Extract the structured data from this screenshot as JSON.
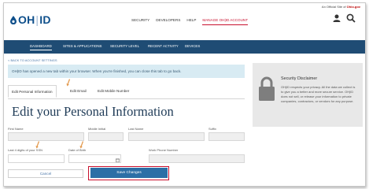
{
  "official_site": {
    "prefix": "An Official Site of",
    "state": "Ohio.gov"
  },
  "brand": {
    "left": "OH",
    "right": "ID"
  },
  "main_nav": [
    "SECURITY",
    "DEVELOPERS",
    "HELP",
    "MANAGE OH|ID ACCOUNT"
  ],
  "sub_nav": [
    "DASHBOARD",
    "SITES & APPLICATIONS",
    "SECURITY LEVEL",
    "RECENT ACTIVITY",
    "DEVICES"
  ],
  "back_link": "< BACK TO ACCOUNT SETTINGS",
  "notice": "OH|ID has opened a new tab within your browser. When you're finished, you can close this tab to go back.",
  "tabs": [
    "Edit Personal Information",
    "Edit Email",
    "Edit Mobile Number"
  ],
  "form": {
    "title": "Edit your Personal Information",
    "labels": {
      "first_name": "First Name",
      "middle_initial": "Middle Initial",
      "last_name": "Last Name",
      "suffix": "Suffix",
      "ssn": "Last 4 digits of your SSN",
      "dob": "Date of Birth",
      "work_phone": "Work Phone Number"
    },
    "cancel_label": "Cancel",
    "save_label": "Save Changes"
  },
  "disclaimer": {
    "title": "Security Disclaimer",
    "body": "OH|ID respects your privacy. All the data we collect is to give you a better and more secure service. OH|ID does not sell, or release your information to private companies, contractors, or vendors for any purpose."
  },
  "colors": {
    "brand_blue": "#0e4f8b",
    "nav_bar": "#1f4c74",
    "accent_red": "#c8102e",
    "button_blue": "#2c6fa6",
    "annotation_orange": "#e39a4f"
  }
}
